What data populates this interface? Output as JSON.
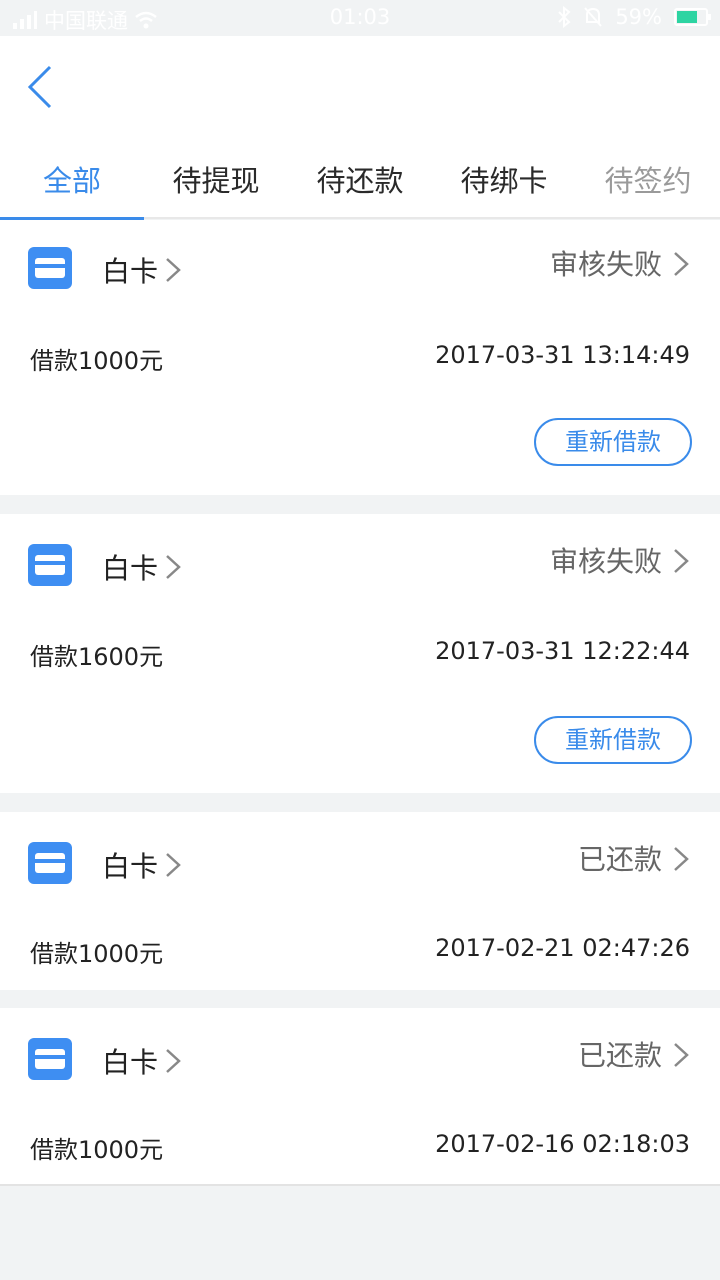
{
  "status_bar": {
    "carrier": "中国联通",
    "time": "01:03",
    "battery": "59%"
  },
  "tabs": [
    {
      "label": "全部",
      "active": true
    },
    {
      "label": "待提现",
      "active": false
    },
    {
      "label": "待还款",
      "active": false
    },
    {
      "label": "待绑卡",
      "active": false
    },
    {
      "label": "待签约",
      "active": false
    }
  ],
  "orders": [
    {
      "product": "白卡",
      "status": "审核失败",
      "amount": "借款1000元",
      "datetime": "2017-03-31 13:14:49",
      "action": "重新借款"
    },
    {
      "product": "白卡",
      "status": "审核失败",
      "amount": "借款1600元",
      "datetime": "2017-03-31 12:22:44",
      "action": "重新借款"
    },
    {
      "product": "白卡",
      "status": "已还款",
      "amount": "借款1000元",
      "datetime": "2017-02-21 02:47:26"
    },
    {
      "product": "白卡",
      "status": "已还款",
      "amount": "借款1000元",
      "datetime": "2017-02-16 02:18:03"
    }
  ],
  "colors": {
    "accent": "#3a8bea",
    "card_icon": "#3e8ef2",
    "background": "#f1f3f4"
  }
}
